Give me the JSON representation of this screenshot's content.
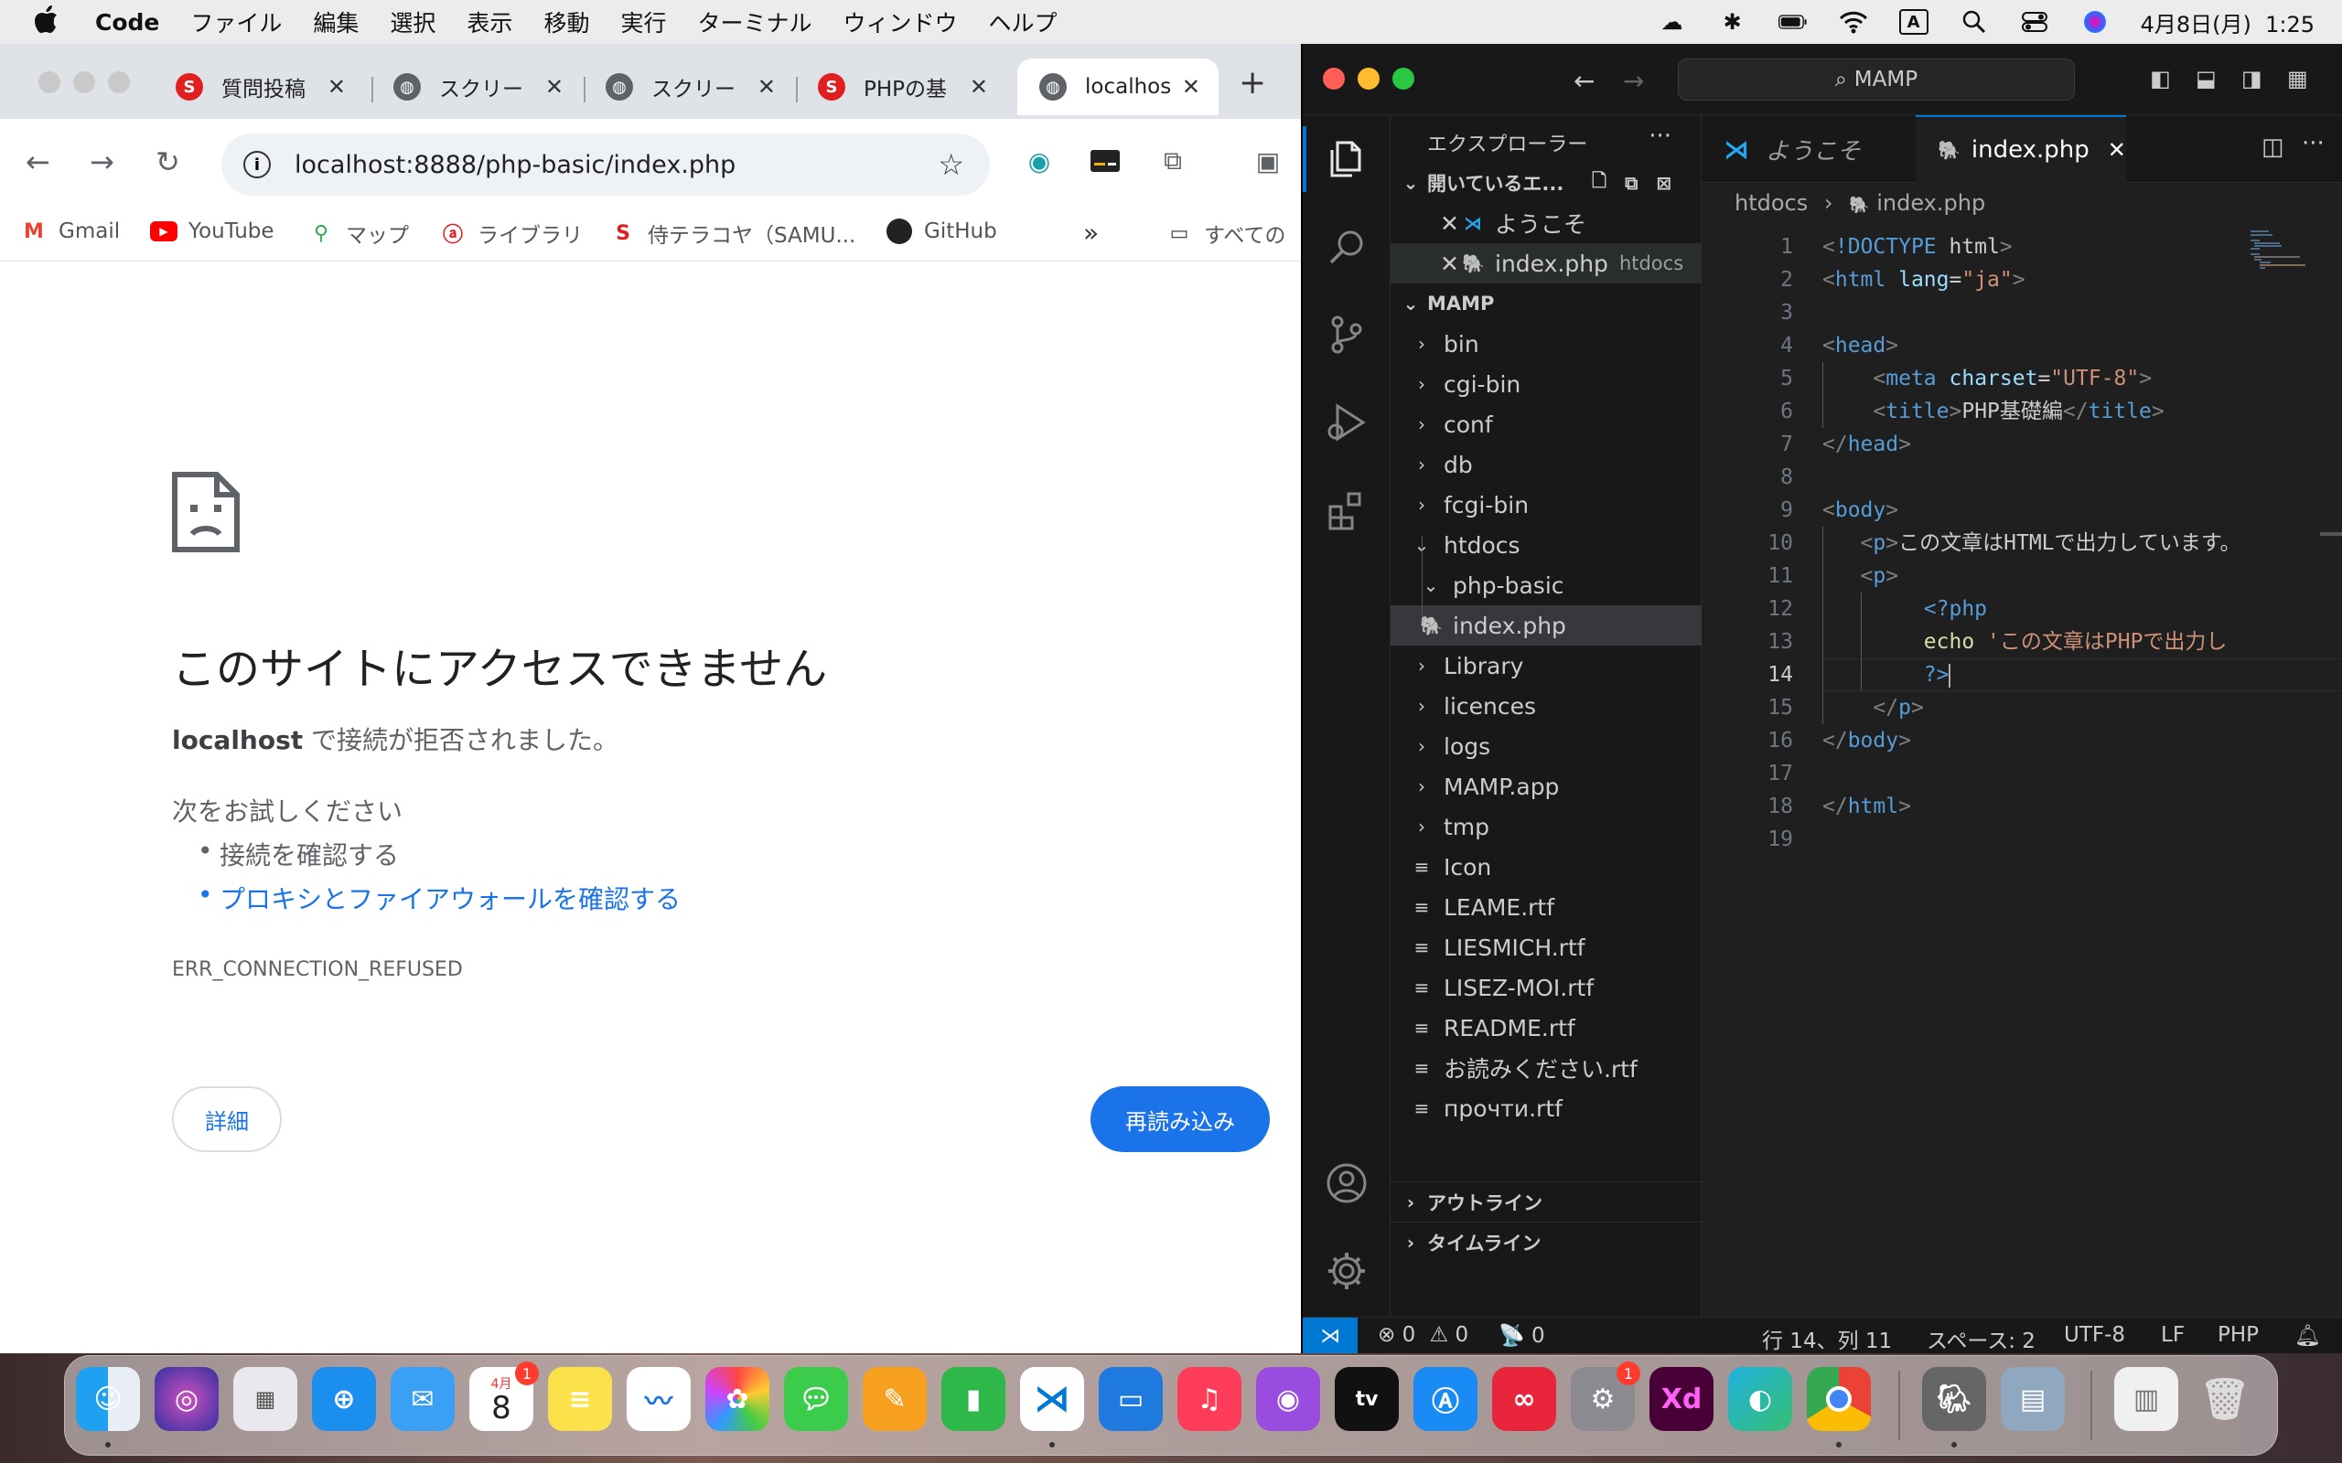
{
  "menubar": {
    "app": "Code",
    "items": [
      "ファイル",
      "編集",
      "選択",
      "表示",
      "移動",
      "実行",
      "ターミナル",
      "ウィンドウ",
      "ヘルプ"
    ],
    "clock": "4月8日(月)  1:25"
  },
  "chrome": {
    "tabs": [
      {
        "title": "質問投稿",
        "icon": "samurai-icon"
      },
      {
        "title": "スクリー",
        "icon": "globe-icon"
      },
      {
        "title": "スクリー",
        "icon": "globe-icon"
      },
      {
        "title": "PHPの基",
        "icon": "samurai-icon"
      },
      {
        "title": "localhos",
        "icon": "globe-icon"
      }
    ],
    "url": "localhost:8888/php-basic/index.php",
    "bookmarks": [
      "Gmail",
      "YouTube",
      "マップ",
      "ライブラリ",
      "侍テラコヤ（SAMU...",
      "GitHub"
    ],
    "bookmarks_folder": "すべての",
    "error": {
      "title": "このサイトにアクセスできません",
      "host": "localhost",
      "desc": " で接続が拒否されました。",
      "try_title": "次をお試しください",
      "try_items": [
        "接続を確認する",
        "プロキシとファイアウォールを確認する"
      ],
      "code": "ERR_CONNECTION_REFUSED",
      "details_btn": "詳細",
      "reload_btn": "再読み込み"
    }
  },
  "vscode": {
    "search": "MAMP",
    "explorer_title": "エクスプローラー",
    "open_editors": "開いているエ...",
    "open_files": [
      {
        "name": "ようこそ",
        "desc": ""
      },
      {
        "name": "index.php",
        "desc": "htdocs"
      }
    ],
    "root": "MAMP",
    "tree": [
      {
        "name": "bin",
        "type": "folder",
        "depth": 1
      },
      {
        "name": "cgi-bin",
        "type": "folder",
        "depth": 1
      },
      {
        "name": "conf",
        "type": "folder",
        "depth": 1
      },
      {
        "name": "db",
        "type": "folder",
        "depth": 1
      },
      {
        "name": "fcgi-bin",
        "type": "folder",
        "depth": 1
      },
      {
        "name": "htdocs",
        "type": "folder-open",
        "depth": 1
      },
      {
        "name": "php-basic",
        "type": "folder-open",
        "depth": 2
      },
      {
        "name": "index.php",
        "type": "php",
        "depth": 2
      },
      {
        "name": "Library",
        "type": "folder",
        "depth": 1
      },
      {
        "name": "licences",
        "type": "folder",
        "depth": 1
      },
      {
        "name": "logs",
        "type": "folder",
        "depth": 1
      },
      {
        "name": "MAMP.app",
        "type": "folder",
        "depth": 1
      },
      {
        "name": "tmp",
        "type": "folder",
        "depth": 1
      },
      {
        "name": "Icon",
        "type": "file",
        "depth": 1
      },
      {
        "name": "LEAME.rtf",
        "type": "file",
        "depth": 1
      },
      {
        "name": "LIESMICH.rtf",
        "type": "file",
        "depth": 1
      },
      {
        "name": "LISEZ-MOI.rtf",
        "type": "file",
        "depth": 1
      },
      {
        "name": "README.rtf",
        "type": "file",
        "depth": 1
      },
      {
        "name": "お読みください.rtf",
        "type": "file",
        "depth": 1
      },
      {
        "name": "прочти.rtf",
        "type": "file",
        "depth": 1
      }
    ],
    "outline": "アウトライン",
    "timeline": "タイムライン",
    "tabs": [
      "ようこそ",
      "index.php"
    ],
    "breadcrumb": [
      "htdocs",
      "index.php"
    ],
    "line_count": 19,
    "current_line": 14,
    "code": [
      "<!DOCTYPE html>",
      "<html lang=\"ja\">",
      "",
      "<head>",
      "    <meta charset=\"UTF-8\">",
      "    <title>PHP基礎編</title>",
      "</head>",
      "",
      "<body>",
      "   <p>この文章はHTMLで出力しています。",
      "   <p>",
      "        <?php",
      "        echo 'この文章はPHPで出力し",
      "        ?>",
      "    </p>",
      "</body>",
      "",
      "</html>",
      ""
    ],
    "status": {
      "errors": "0",
      "warnings": "0",
      "ports": "0",
      "position": "行 14、列 11",
      "spaces": "スペース: 2",
      "encoding": "UTF-8",
      "eol": "LF",
      "language": "PHP"
    }
  },
  "dock": {
    "calendar_month": "4月",
    "calendar_day": "8",
    "badges": {
      "calendar": "1",
      "settings": "1"
    }
  }
}
